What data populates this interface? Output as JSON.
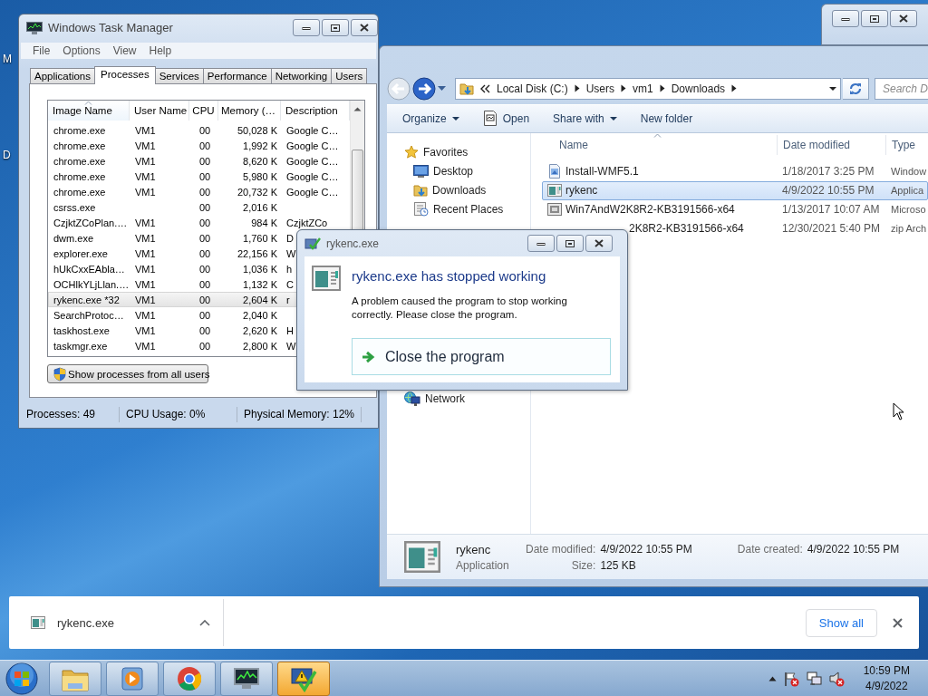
{
  "desktop_labels": [
    "M",
    "D"
  ],
  "task_manager": {
    "title": "Windows Task Manager",
    "menu": [
      "File",
      "Options",
      "View",
      "Help"
    ],
    "tabs": [
      {
        "label": "Applications",
        "selected": false
      },
      {
        "label": "Processes",
        "selected": true
      },
      {
        "label": "Services",
        "selected": false
      },
      {
        "label": "Performance",
        "selected": false
      },
      {
        "label": "Networking",
        "selected": false
      },
      {
        "label": "Users",
        "selected": false
      }
    ],
    "columns": [
      "Image Name",
      "User Name",
      "CPU",
      "Memory (…",
      "Description"
    ],
    "rows": [
      {
        "cells": [
          "chrome.exe",
          "VM1",
          "00",
          "50,028 K",
          "Google C…"
        ],
        "selected": false
      },
      {
        "cells": [
          "chrome.exe",
          "VM1",
          "00",
          "1,992 K",
          "Google C…"
        ],
        "selected": false
      },
      {
        "cells": [
          "chrome.exe",
          "VM1",
          "00",
          "8,620 K",
          "Google C…"
        ],
        "selected": false
      },
      {
        "cells": [
          "chrome.exe",
          "VM1",
          "00",
          "5,980 K",
          "Google C…"
        ],
        "selected": false
      },
      {
        "cells": [
          "chrome.exe",
          "VM1",
          "00",
          "20,732 K",
          "Google C…"
        ],
        "selected": false
      },
      {
        "cells": [
          "csrss.exe",
          "",
          "00",
          "2,016 K"
        ],
        "selected": false
      },
      {
        "cells": [
          "CzjktZCoPlan.…",
          "VM1",
          "00",
          "984 K",
          "CzjktZCo"
        ],
        "selected": false
      },
      {
        "cells": [
          "dwm.exe",
          "VM1",
          "00",
          "1,760 K",
          "D"
        ],
        "selected": false
      },
      {
        "cells": [
          "explorer.exe",
          "VM1",
          "00",
          "22,156 K",
          "W"
        ],
        "selected": false
      },
      {
        "cells": [
          "hUkCxxEAbla…",
          "VM1",
          "00",
          "1,036 K",
          "h"
        ],
        "selected": false
      },
      {
        "cells": [
          "OCHlkYLjLlan.…",
          "VM1",
          "00",
          "1,132 K",
          "C"
        ],
        "selected": false
      },
      {
        "cells": [
          "rykenc.exe *32",
          "VM1",
          "00",
          "2,604 K",
          "r"
        ],
        "selected": true
      },
      {
        "cells": [
          "SearchProtoc…",
          "VM1",
          "00",
          "2,040 K"
        ],
        "selected": false
      },
      {
        "cells": [
          "taskhost.exe",
          "VM1",
          "00",
          "2,620 K",
          "H"
        ],
        "selected": false
      },
      {
        "cells": [
          "taskmgr.exe",
          "VM1",
          "00",
          "2,800 K",
          "W"
        ],
        "selected": false
      }
    ],
    "show_all_button": "Show processes from all users",
    "status": [
      "Processes: 49",
      "CPU Usage: 0%",
      "Physical Memory: 12%"
    ]
  },
  "explorer": {
    "breadcrumb": [
      "Local Disk (C:)",
      "Users",
      "vm1",
      "Downloads"
    ],
    "search": {
      "placeholder": "Search D"
    },
    "toolbar": [
      {
        "label": "Organize",
        "kind": "menu"
      },
      {
        "label": "Open",
        "kind": "open"
      },
      {
        "label": "Share with",
        "kind": "menu"
      },
      {
        "label": "New folder",
        "kind": "plain"
      }
    ],
    "nav": [
      {
        "label": "Favorites",
        "kind": "favorites",
        "children": [
          {
            "label": "Desktop",
            "kind": "desktop"
          },
          {
            "label": "Downloads",
            "kind": "downloads"
          },
          {
            "label": "Recent Places",
            "kind": "recent"
          }
        ]
      },
      {
        "label": "Network",
        "kind": "network"
      }
    ],
    "columns": [
      "Name",
      "Date modified",
      "Type"
    ],
    "files": [
      {
        "name": "Install-WMF5.1",
        "date": "1/18/2017 3:25 PM",
        "type": "Window",
        "kind": "document",
        "selected": false
      },
      {
        "name": "rykenc",
        "date": "4/9/2022 10:55 PM",
        "type": "Applica",
        "kind": "app",
        "selected": true
      },
      {
        "name": "Win7AndW2K8R2-KB3191566-x64",
        "date": "1/13/2017 10:07 AM",
        "type": "Microso",
        "kind": "package",
        "selected": false
      },
      {
        "name": "2K8R2-KB3191566-x64",
        "date": "12/30/2021 5:40 PM",
        "type": "zip Arch",
        "kind": "covered",
        "selected": false
      }
    ],
    "details": {
      "name": "rykenc",
      "type": "Application",
      "fields": [
        {
          "label": "Date modified:",
          "value": "4/9/2022 10:55 PM"
        },
        {
          "label": "Size:",
          "value": "125 KB"
        },
        {
          "label": "Date created:",
          "value": "4/9/2022 10:55 PM"
        }
      ]
    }
  },
  "dialog": {
    "title": "rykenc.exe",
    "heading": "rykenc.exe has stopped working",
    "message": "A problem caused the program to stop working correctly. Please close the program.",
    "action": "Close the program"
  },
  "download_bar": {
    "file": "rykenc.exe",
    "show_all": "Show all"
  },
  "taskbar": {
    "apps": [
      {
        "kind": "folder",
        "selected": false
      },
      {
        "kind": "media",
        "selected": false
      },
      {
        "kind": "browser",
        "selected": false
      },
      {
        "kind": "monitor",
        "selected": false
      },
      {
        "kind": "error",
        "selected": true
      }
    ],
    "clock": {
      "time": "10:59 PM",
      "date": "4/9/2022"
    }
  }
}
